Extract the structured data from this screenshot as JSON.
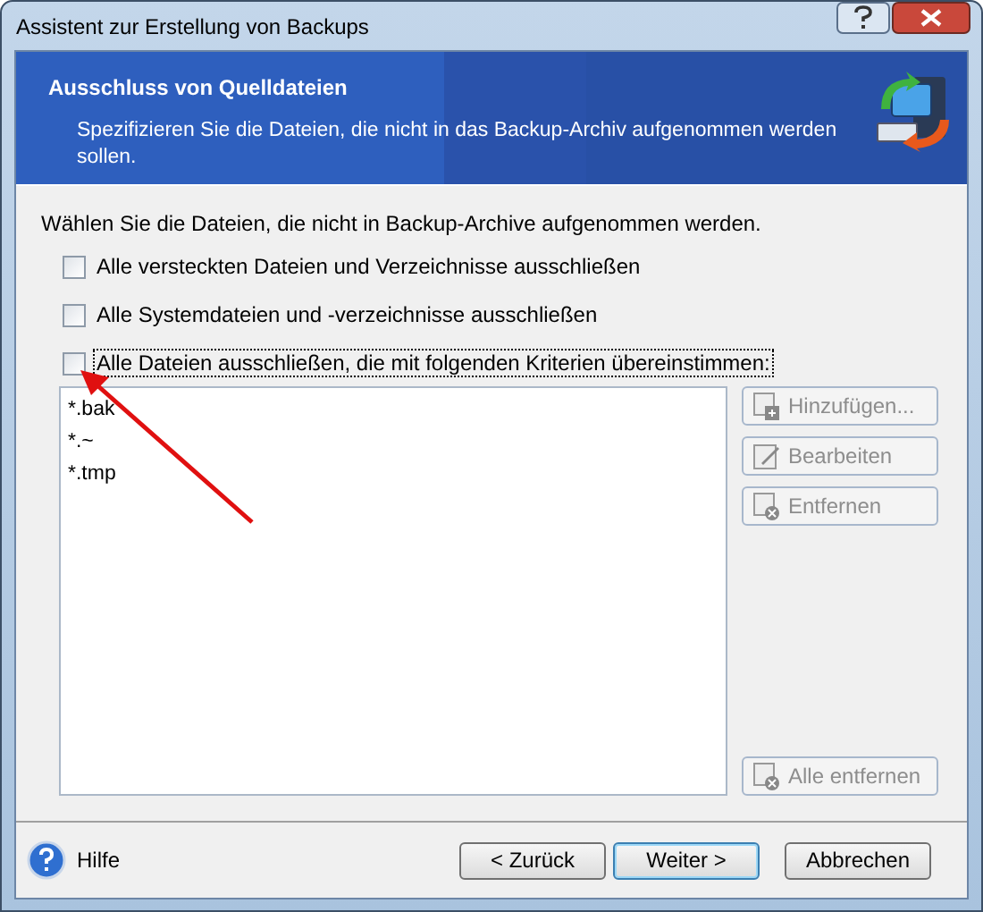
{
  "window": {
    "title": "Assistent zur Erstellung von Backups"
  },
  "header": {
    "title": "Ausschluss von Quelldateien",
    "description": "Spezifizieren Sie die Dateien, die nicht in das Backup-Archiv aufgenommen werden sollen."
  },
  "instruction": "Wählen Sie die Dateien, die nicht in Backup-Archive aufgenommen werden.",
  "options": [
    {
      "label": "Alle versteckten Dateien und Verzeichnisse ausschließen",
      "checked": false
    },
    {
      "label": "Alle Systemdateien und -verzeichnisse ausschließen",
      "checked": false
    },
    {
      "label": "Alle Dateien ausschließen, die mit folgenden Kriterien übereinstimmen:",
      "checked": false
    }
  ],
  "criteria": [
    "*.bak",
    "*.~",
    "*.tmp"
  ],
  "list_buttons": [
    {
      "label": "Hinzufügen...",
      "kind": "add",
      "disabled": true
    },
    {
      "label": "Bearbeiten",
      "kind": "edit",
      "disabled": true
    },
    {
      "label": "Entfernen",
      "kind": "remove",
      "disabled": true
    }
  ],
  "remove_all_button": {
    "label": "Alle entfernen",
    "disabled": true
  },
  "footer": {
    "help": "Hilfe",
    "buttons": [
      {
        "label": "< Zurück",
        "default": false
      },
      {
        "label": "Weiter >",
        "default": true
      },
      {
        "label": "Abbrechen",
        "default": false
      }
    ]
  }
}
